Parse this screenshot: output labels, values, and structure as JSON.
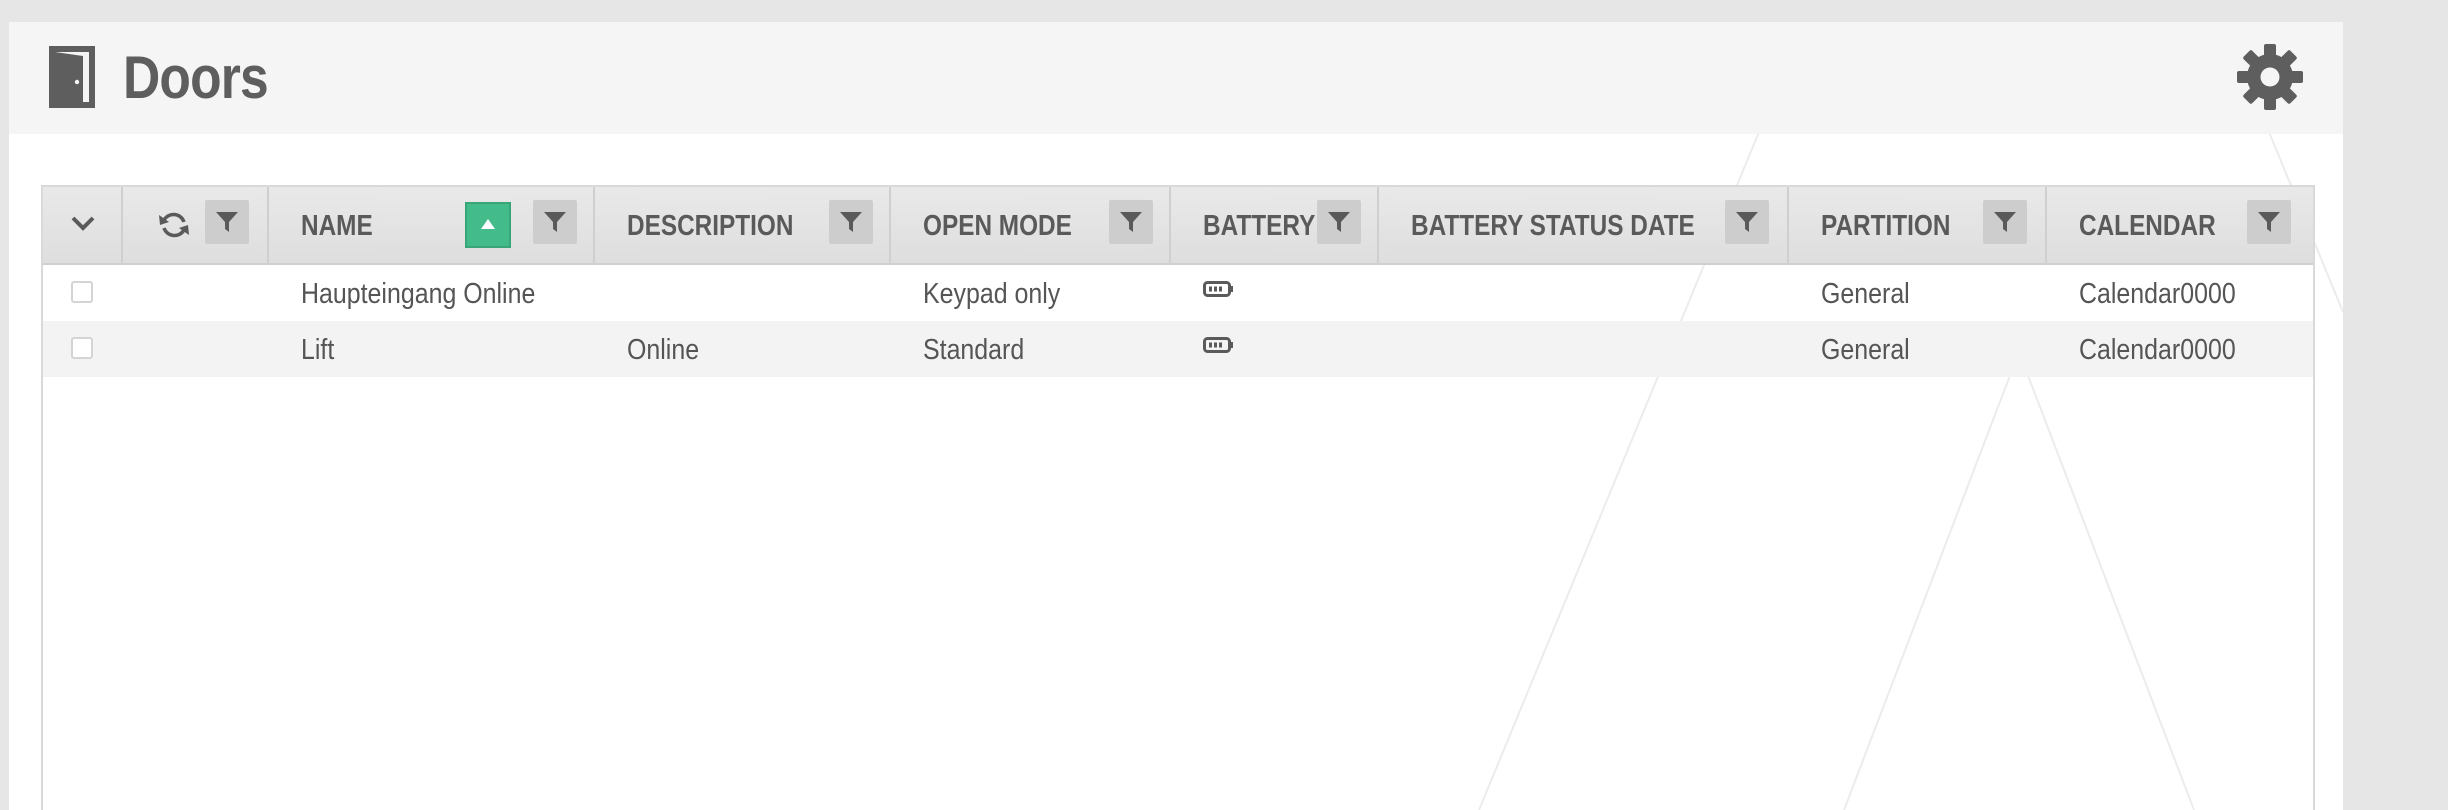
{
  "header": {
    "title": "Doors",
    "icon": "door-icon",
    "settings_icon": "gear-icon"
  },
  "grid": {
    "columns": [
      {
        "key": "select",
        "label": "",
        "icon": "chevron-down-icon"
      },
      {
        "key": "refresh",
        "label": "",
        "icon": "refresh-icon"
      },
      {
        "key": "name",
        "label": "NAME",
        "sorted": "ascending"
      },
      {
        "key": "description",
        "label": "DESCRIPTION"
      },
      {
        "key": "open_mode",
        "label": "OPEN MODE"
      },
      {
        "key": "battery",
        "label": "BATTERY"
      },
      {
        "key": "battery_status_date",
        "label": "BATTERY STATUS DATE"
      },
      {
        "key": "partition",
        "label": "PARTITION"
      },
      {
        "key": "calendar",
        "label": "CALENDAR"
      }
    ],
    "rows": [
      {
        "checked": false,
        "name": "Haupteingang Online",
        "description": "",
        "open_mode": "Keypad only",
        "battery": "battery-icon",
        "battery_status_date": "",
        "partition": "General",
        "calendar": "Calendar0000"
      },
      {
        "checked": false,
        "name": "Lift",
        "description": "Online",
        "open_mode": "Standard",
        "battery": "battery-icon",
        "battery_status_date": "",
        "partition": "General",
        "calendar": "Calendar0000"
      }
    ]
  },
  "colors": {
    "sort_active": "#44bb8a",
    "header_bg": "#f5f5f5",
    "page_bg": "#e6e6e6"
  }
}
